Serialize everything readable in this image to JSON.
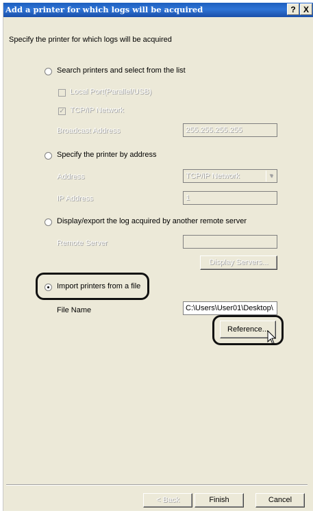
{
  "window": {
    "title": "Add a printer for which logs will be acquired",
    "help_icon": "?",
    "close_icon": "X"
  },
  "intro": "Specify the printer for which logs will be acquired",
  "search_option": {
    "label": "Search printers and select from the list",
    "local_port": "Local Port(Parallel/USB)",
    "tcpip": "TCP/IP Network",
    "broadcast_label": "Broadcast Address",
    "broadcast_value": "255.255.255.255"
  },
  "address_option": {
    "label": "Specify the printer by address",
    "address_label": "Address",
    "address_value": "TCP/IP Network",
    "ip_label": "IP Address",
    "ip_value": "1"
  },
  "remote_option": {
    "label": "Display/export the log acquired by another remote server",
    "server_label": "Remote Server",
    "server_value": "",
    "display_servers": "Display Servers..."
  },
  "import_option": {
    "label": "Import printers from a file",
    "file_label": "File Name",
    "file_value": "C:\\Users\\User01\\Desktop\\",
    "reference": "Reference..."
  },
  "footer": {
    "back": "< Back",
    "finish": "Finish",
    "cancel": "Cancel"
  }
}
